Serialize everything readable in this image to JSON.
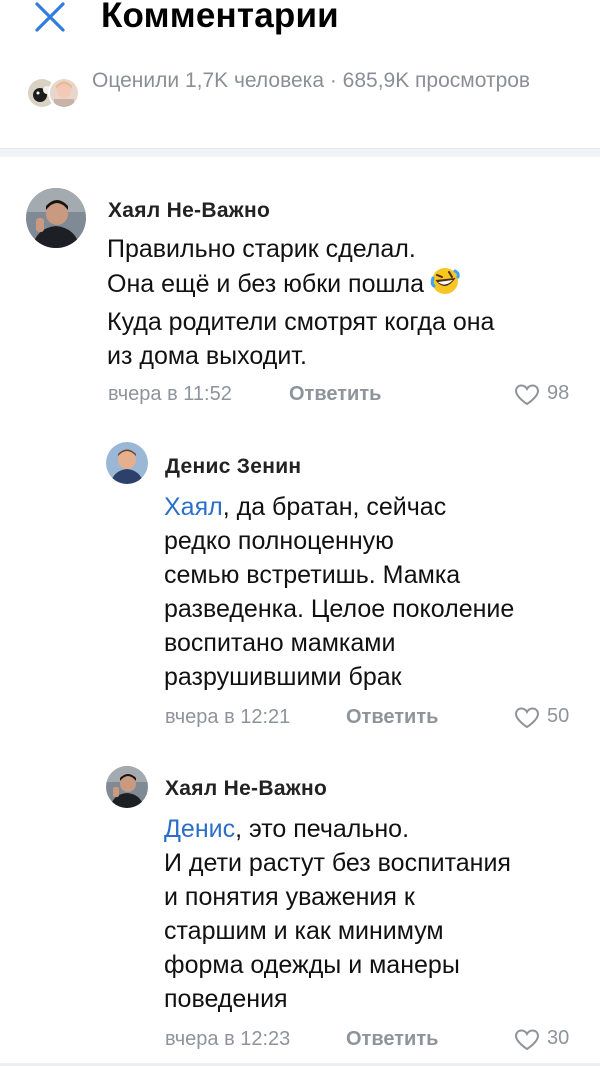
{
  "header": {
    "title": "Комментарии",
    "close_icon": "close-icon"
  },
  "stats": {
    "text": "Оценили 1,7K человека · 685,9K просмотров"
  },
  "comments": [
    {
      "author": "Хаял Не-Важно",
      "text_lines": [
        "Правильно старик сделал.",
        "Она ещё и без юбки пошла",
        "Куда родители смотрят когда она",
        "из дома выходит."
      ],
      "emoji": "rolling-on-floor-laughing-emoji",
      "time": "вчера в 11:52",
      "reply_label": "Ответить",
      "likes": "98"
    },
    {
      "author": "Денис Зенин",
      "mention": "Хаял",
      "first_line_rest": ", да братан, сейчас",
      "text_lines": [
        "редко полноценную",
        "семью встретишь. Мамка",
        "разведенка. Целое поколение",
        "воспитано мамками",
        "разрушившими брак"
      ],
      "time": "вчера в 12:21",
      "reply_label": "Ответить",
      "likes": "50"
    },
    {
      "author": "Хаял Не-Важно",
      "mention": "Денис",
      "first_line_rest": ", это печально.",
      "text_lines": [
        "И дети растут без воспитания",
        "и понятия уважения к",
        "старшим и как минимум",
        "форма одежды и манеры",
        "поведения"
      ],
      "time": "вчера в 12:23",
      "reply_label": "Ответить",
      "likes": "30"
    }
  ],
  "colors": {
    "mention": "#2a6fc9",
    "close_icon": "#2f7de1",
    "meta": "#8e949b"
  }
}
